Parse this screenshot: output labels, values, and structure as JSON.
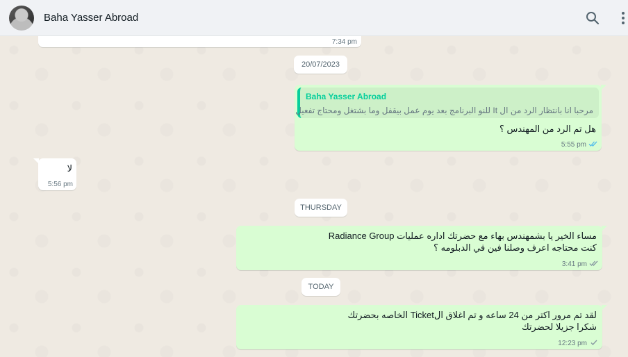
{
  "header": {
    "contact_name": "Baha Yasser Abroad",
    "avatar_icon": "avatar",
    "search_icon": "search-icon",
    "menu_icon": "menu-icon"
  },
  "chat": {
    "prev_message_time": "7:34 pm",
    "date_chips": [
      "20/07/2023",
      "THURSDAY",
      "TODAY"
    ],
    "messages": [
      {
        "direction": "outgoing",
        "quoted_author": "Baha Yasser Abroad",
        "quoted_text": "مرحبا انا بانتظار الرد من ال It للنو البرنامج بعد يوم عمل بيقفل وما بشتغل ومحتاج تفعيل",
        "lines": [
          "هل تم الرد من المهندس ؟"
        ],
        "time": "5:55 pm",
        "status": "read"
      },
      {
        "direction": "incoming",
        "lines": [
          "لا"
        ],
        "time": "5:56 pm"
      },
      {
        "direction": "outgoing",
        "lines": [
          "مساء الخير يا بشمهندس بهاء مع حضرتك اداره عمليات Radiance Group",
          "كنت محتاجه اعرف وصلنا فين في الدبلومه ؟"
        ],
        "time": "3:41 pm",
        "status": "delivered"
      },
      {
        "direction": "outgoing",
        "lines": [
          "لقد تم مرور اكتر من 24 ساعه و تم اغلاق الTicket الخاصه بحضرتك",
          "شكرا جزيلا لحضرتك"
        ],
        "time": "12:23 pm",
        "status": "sent"
      }
    ]
  },
  "colors": {
    "outgoing_bubble": "#d9fdd3",
    "incoming_bubble": "#ffffff",
    "read_ticks": "#53bdeb",
    "quote_accent": "#06cf9c",
    "chat_background": "#efeae2"
  }
}
